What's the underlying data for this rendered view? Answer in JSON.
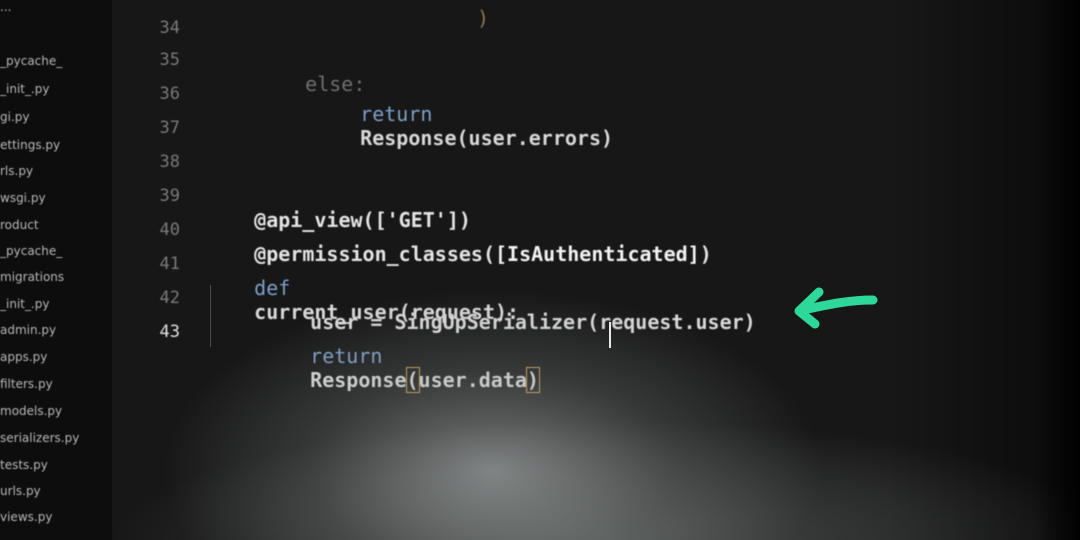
{
  "sidebar": {
    "items": [
      {
        "label": "..."
      },
      {
        "label": "_pycache_"
      },
      {
        "label": "_init_.py"
      },
      {
        "label": "gi.py"
      },
      {
        "label": "ettings.py"
      },
      {
        "label": "rls.py"
      },
      {
        "label": "wsgi.py"
      },
      {
        "label": "roduct"
      },
      {
        "label": "_pycache_"
      },
      {
        "label": "migrations"
      },
      {
        "label": "_init_.py"
      },
      {
        "label": "admin.py"
      },
      {
        "label": "apps.py"
      },
      {
        "label": "filters.py"
      },
      {
        "label": "models.py"
      },
      {
        "label": "serializers.py"
      },
      {
        "label": "tests.py"
      },
      {
        "label": "urls.py"
      },
      {
        "label": "views.py"
      }
    ]
  },
  "editor": {
    "line_numbers": [
      "34",
      "35",
      "36",
      "37",
      "38",
      "39",
      "40",
      "41",
      "42",
      "43"
    ],
    "active_line": "43",
    "lines": {
      "l33_brace": ")",
      "l35_else": "else:",
      "l36_return": "return",
      "l36_rest": "Response(user.errors)",
      "l39_deco": "@api_view(['GET'])",
      "l40_deco_a": "@permission_classes(",
      "l40_deco_b": "[IsAuthenticated]",
      "l40_deco_c": ")",
      "l41_def": "def",
      "l41_rest": "current_user(request):",
      "l42_code": "user = SingUpSerializer(request.user)",
      "l43_return": "return",
      "l43_mid": "Response",
      "l43_paren_open": "(",
      "l43_arg": "user.data",
      "l43_paren_close": ")"
    }
  },
  "colors": {
    "keyword": "#7da0c8",
    "arrow": "#2ed79a",
    "background": "#171717"
  },
  "annotation": {
    "icon": "arrow-left-icon"
  }
}
